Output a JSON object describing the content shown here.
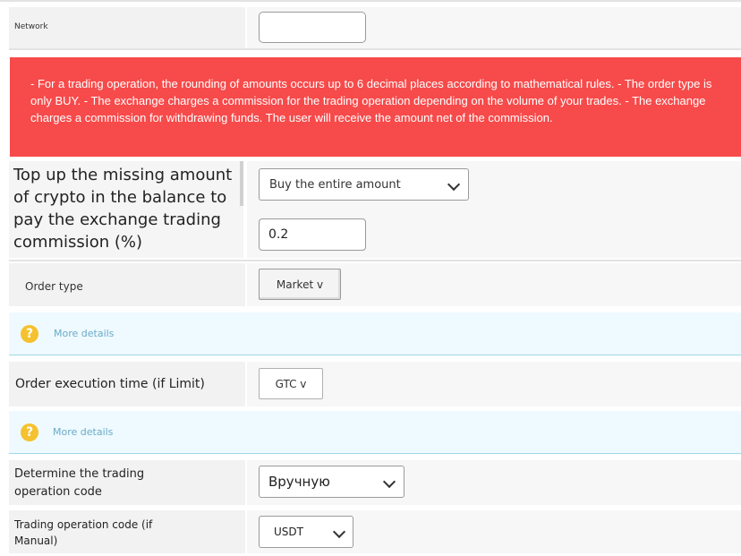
{
  "network": {
    "label": "Network",
    "value": ""
  },
  "warning": {
    "text": "- For a trading operation, the rounding of amounts occurs up to 6 decimal places according to mathematical rules. - The order type is only BUY. - The exchange charges a commission for the trading operation depending on the volume of your trades. - The exchange charges a commission for withdrawing funds. The user will receive the amount net of the commission.",
    "color": "#f74a4a"
  },
  "top_up": {
    "label": "Top up the missing amount of crypto in the balance to pay the exchange trading commission (%)",
    "select_value": "Buy the entire amount",
    "commission_value": "0.2"
  },
  "order_type": {
    "label": "Order type",
    "button": "Market v"
  },
  "info1": {
    "link": "More details",
    "icon": "question-icon"
  },
  "order_exec": {
    "label": "Order execution time (if Limit)",
    "button": "GTC v"
  },
  "info2": {
    "link": "More details",
    "icon": "question-icon"
  },
  "op_code_mode": {
    "label": "Determine the trading operation code",
    "value": "Вручную"
  },
  "op_code": {
    "label": "Trading operation code (if Manual)",
    "value": "USDT"
  }
}
